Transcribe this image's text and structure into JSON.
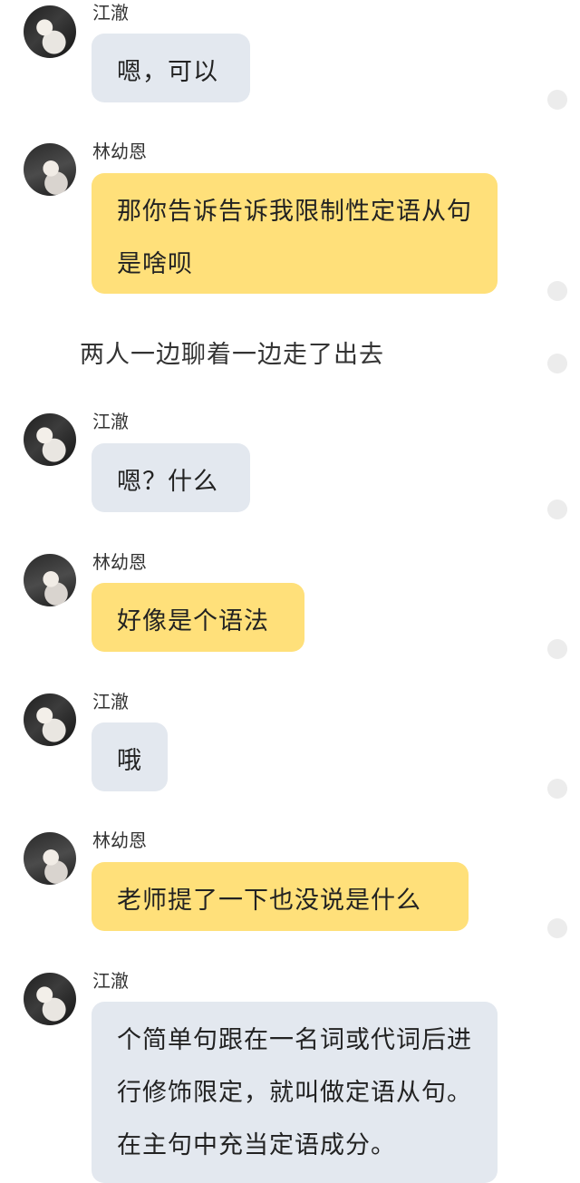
{
  "messages": [
    {
      "speaker": "江澈",
      "text": "嗯，可以"
    },
    {
      "speaker": "林幼恩",
      "text": "那你告诉告诉我限制性定语从句是啥呗"
    },
    {
      "speaker": "江澈",
      "text": "嗯？什么"
    },
    {
      "speaker": "林幼恩",
      "text": "好像是个语法"
    },
    {
      "speaker": "江澈",
      "text": "哦"
    },
    {
      "speaker": "林幼恩",
      "text": "老师提了一下也没说是什么"
    },
    {
      "speaker": "江澈",
      "text": "个简单句跟在一名词或代词后进行修饰限定，就叫做定语从句。在主句中充当定语成分。"
    }
  ],
  "narration": "两人一边聊着一边走了出去",
  "colors": {
    "grey_bubble": "#e3e8ef",
    "yellow_bubble": "#ffe07a",
    "background": "#ffffff"
  }
}
